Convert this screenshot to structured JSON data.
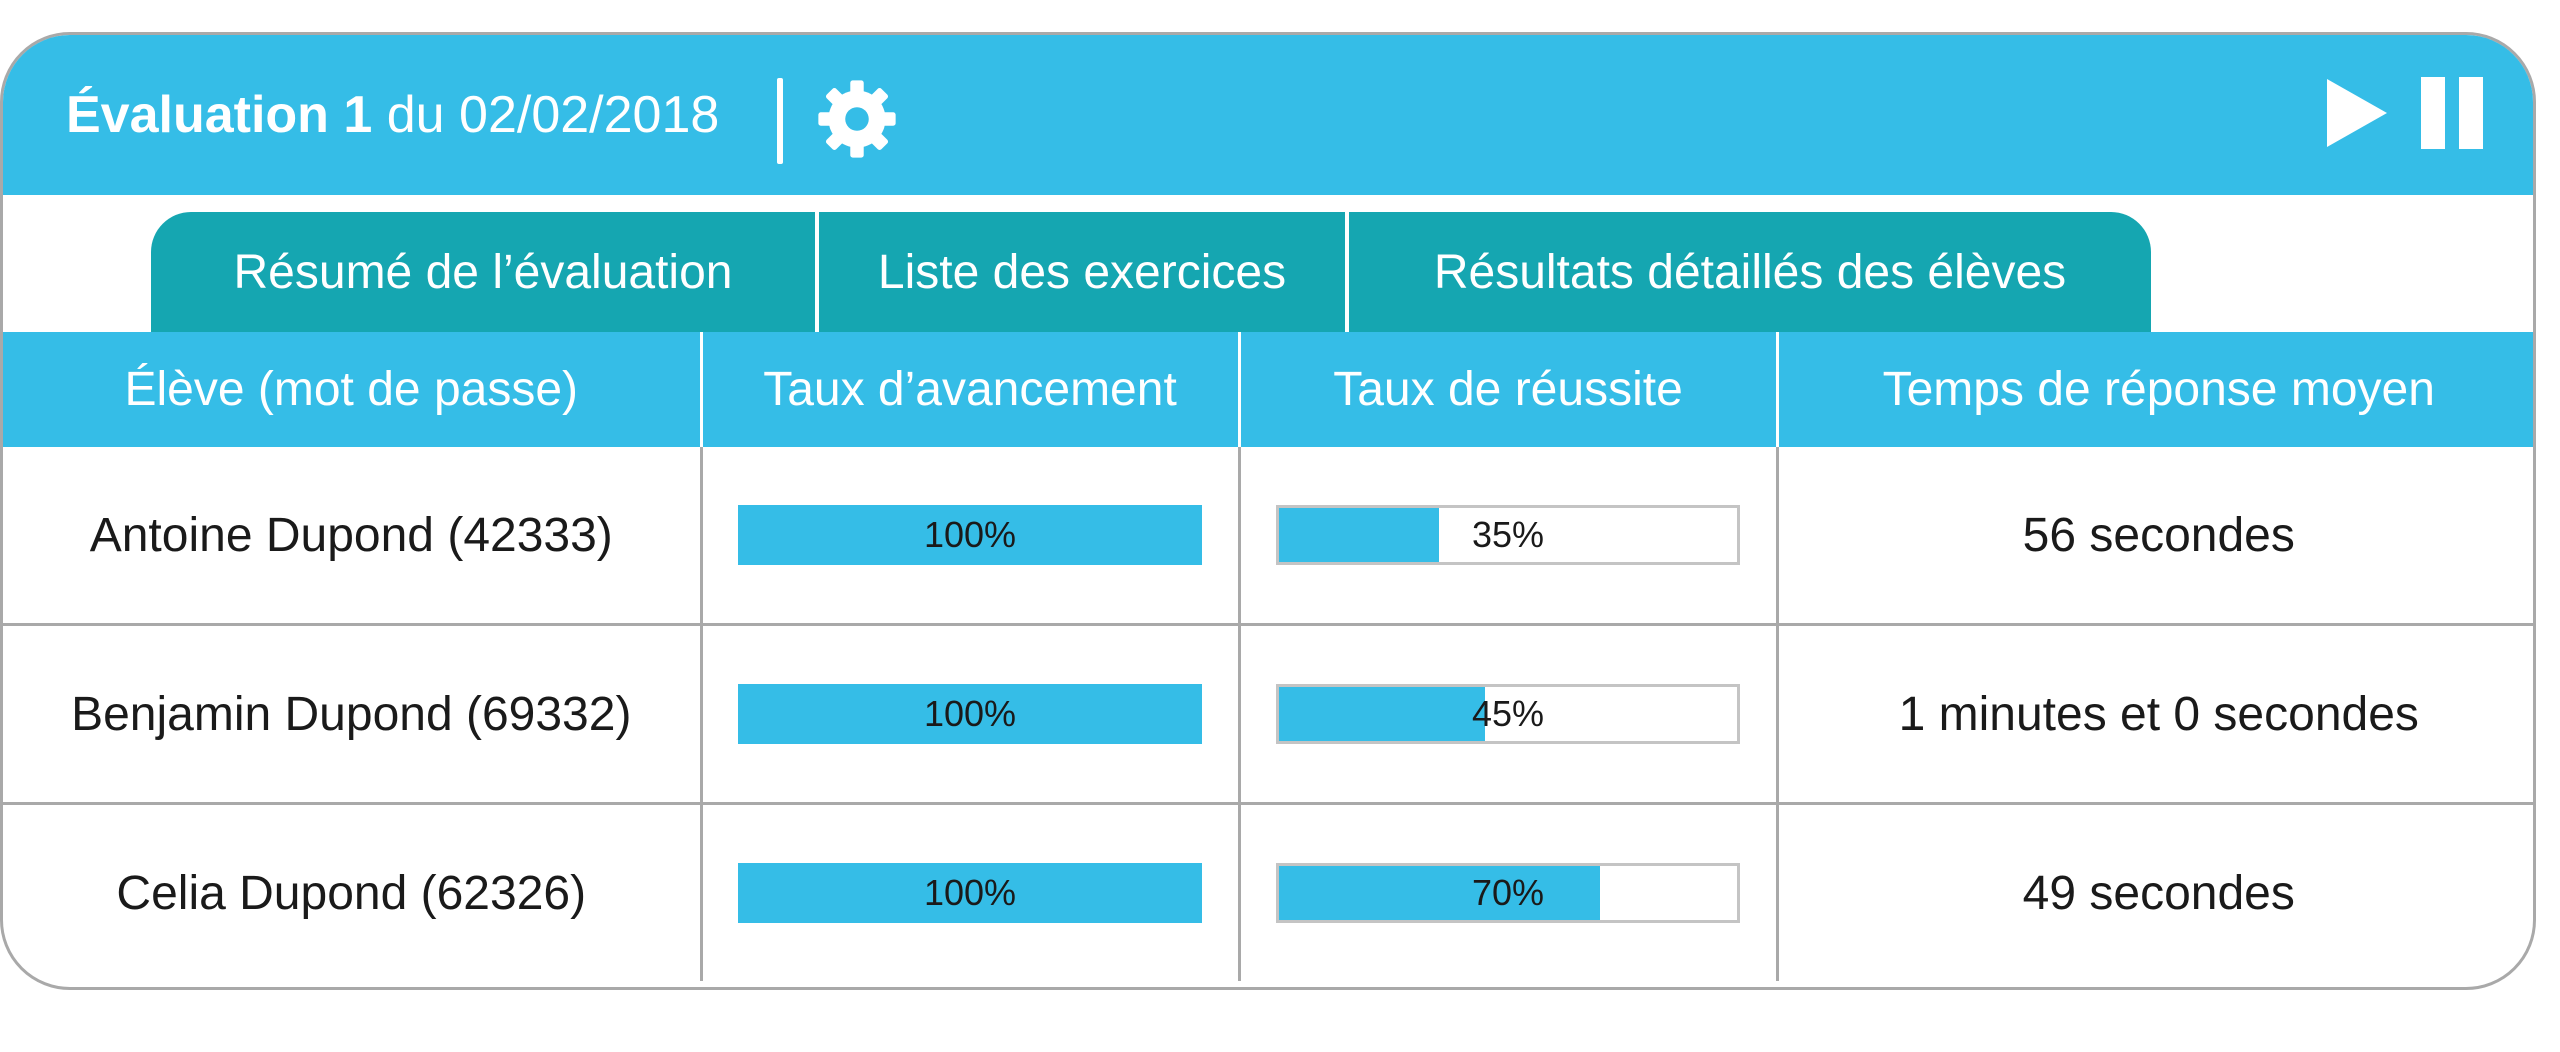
{
  "header": {
    "title_bold": "Évaluation 1",
    "title_rest": " du 02/02/2018",
    "settings_icon": "gear-icon",
    "play_icon": "play-icon",
    "pause_icon": "pause-icon",
    "color": "#35bde7"
  },
  "tabs": [
    {
      "label": "Résumé de l’évaluation"
    },
    {
      "label": "Liste des exercices"
    },
    {
      "label": "Résultats détaillés des élèves"
    }
  ],
  "table": {
    "columns": [
      "Élève (mot de passe)",
      "Taux d’avancement",
      "Taux de réussite",
      "Temps de réponse moyen"
    ],
    "rows": [
      {
        "student": "Antoine Dupond (42333)",
        "progress": 100,
        "progress_label": "100%",
        "success": 35,
        "success_label": "35%",
        "time": "56 secondes"
      },
      {
        "student": "Benjamin Dupond (69332)",
        "progress": 100,
        "progress_label": "100%",
        "success": 45,
        "success_label": "45%",
        "time": "1 minutes et 0 secondes"
      },
      {
        "student": "Celia Dupond (62326)",
        "progress": 100,
        "progress_label": "100%",
        "success": 70,
        "success_label": "70%",
        "time": "49 secondes"
      }
    ]
  },
  "colors": {
    "header_blue": "#35bde7",
    "tab_teal": "#15a6b1",
    "border_gray": "#a9a9a9"
  }
}
